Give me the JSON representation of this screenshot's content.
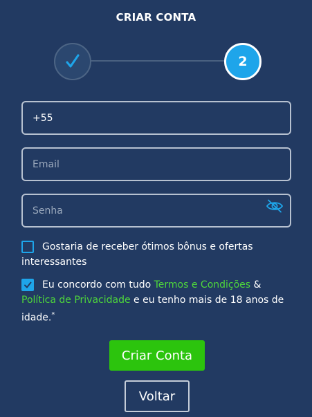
{
  "page": {
    "title": "CRIAR CONTA"
  },
  "stepper": {
    "step2_label": "2"
  },
  "form": {
    "phone": {
      "value": "+55"
    },
    "email": {
      "placeholder": "Email"
    },
    "password": {
      "placeholder": "Senha"
    }
  },
  "checkboxes": {
    "bonus": {
      "text": "Gostaria de receber ótimos bônus e ofertas interessantes",
      "checked": false
    },
    "terms": {
      "checked": true,
      "prefix": "Eu concordo com tudo ",
      "terms_link": "Termos e Condições",
      "middle": " & ",
      "privacy_link": "Política de Privacidade",
      "suffix": " e eu tenho mais de 18 anos de idade.",
      "asterisk": "*"
    }
  },
  "buttons": {
    "create": "Criar Conta",
    "back": "Voltar"
  },
  "colors": {
    "background": "#223a62",
    "accent": "#1ea5ea",
    "primary_button": "#2cc40d",
    "link": "#4ed73b"
  }
}
